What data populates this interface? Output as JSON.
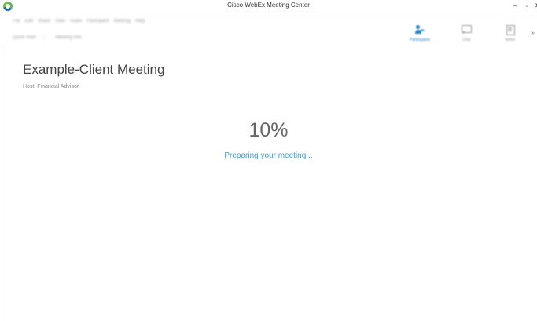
{
  "window": {
    "title": "Cisco WebEx Meeting Center",
    "controls": {
      "minimize": "–",
      "maximize": "▫",
      "close": "✕"
    }
  },
  "menubar": {
    "items": [
      "File",
      "Edit",
      "Share",
      "View",
      "Audio",
      "Participant",
      "Meeting",
      "Help"
    ]
  },
  "toolbar": {
    "items": [
      "Quick Start",
      "Meeting Info"
    ]
  },
  "side_panel_buttons": {
    "participants": "Participants",
    "chat": "Chat",
    "notes": "Notes",
    "more": "»"
  },
  "meeting": {
    "title": "Example-Client Meeting",
    "host": "Host:  Financial Advisor"
  },
  "loading": {
    "percent": "10%",
    "progress_fraction": 0.1,
    "status": "Preparing your meeting..."
  },
  "colors": {
    "accent": "#3f9bd6",
    "participants_icon": "#2a83c9"
  }
}
